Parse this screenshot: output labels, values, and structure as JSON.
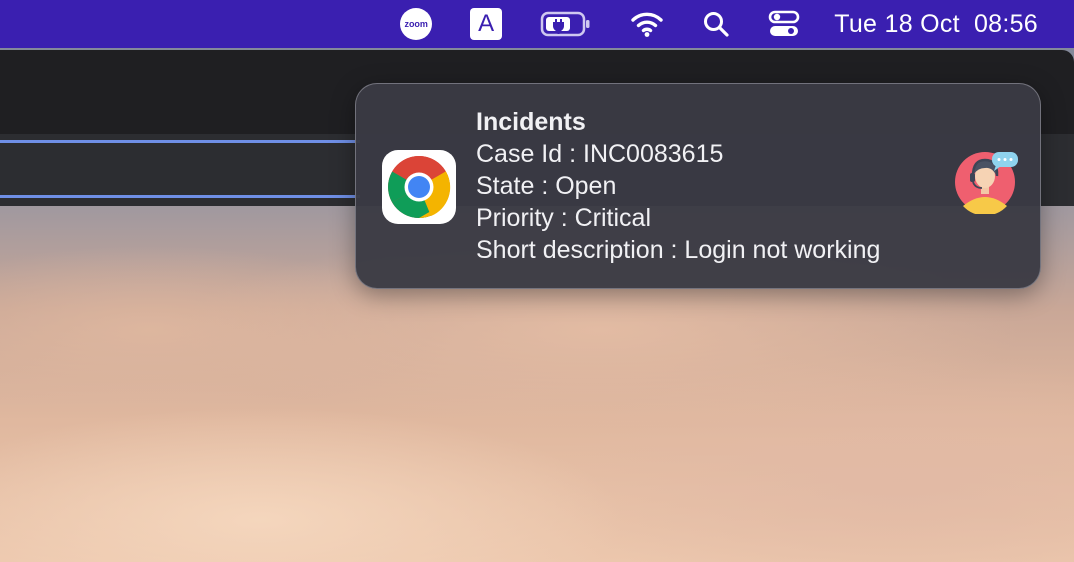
{
  "menubar": {
    "background": "#3a1fb0",
    "zoom_label": "zoom",
    "input_source_label": "A",
    "icons": [
      "zoom-icon",
      "input-source-icon",
      "battery-charging-icon",
      "wifi-icon",
      "spotlight-search-icon",
      "control-center-icon"
    ],
    "clock": {
      "date": "Tue 18 Oct",
      "time": "08:56"
    }
  },
  "notification": {
    "app_icon": "chrome-icon",
    "title": "Incidents",
    "lines": [
      "Case Id : INC0083615",
      "State : Open",
      "Priority : Critical",
      "Short description : Login not working"
    ],
    "avatar_icon": "support-agent-avatar-icon"
  }
}
